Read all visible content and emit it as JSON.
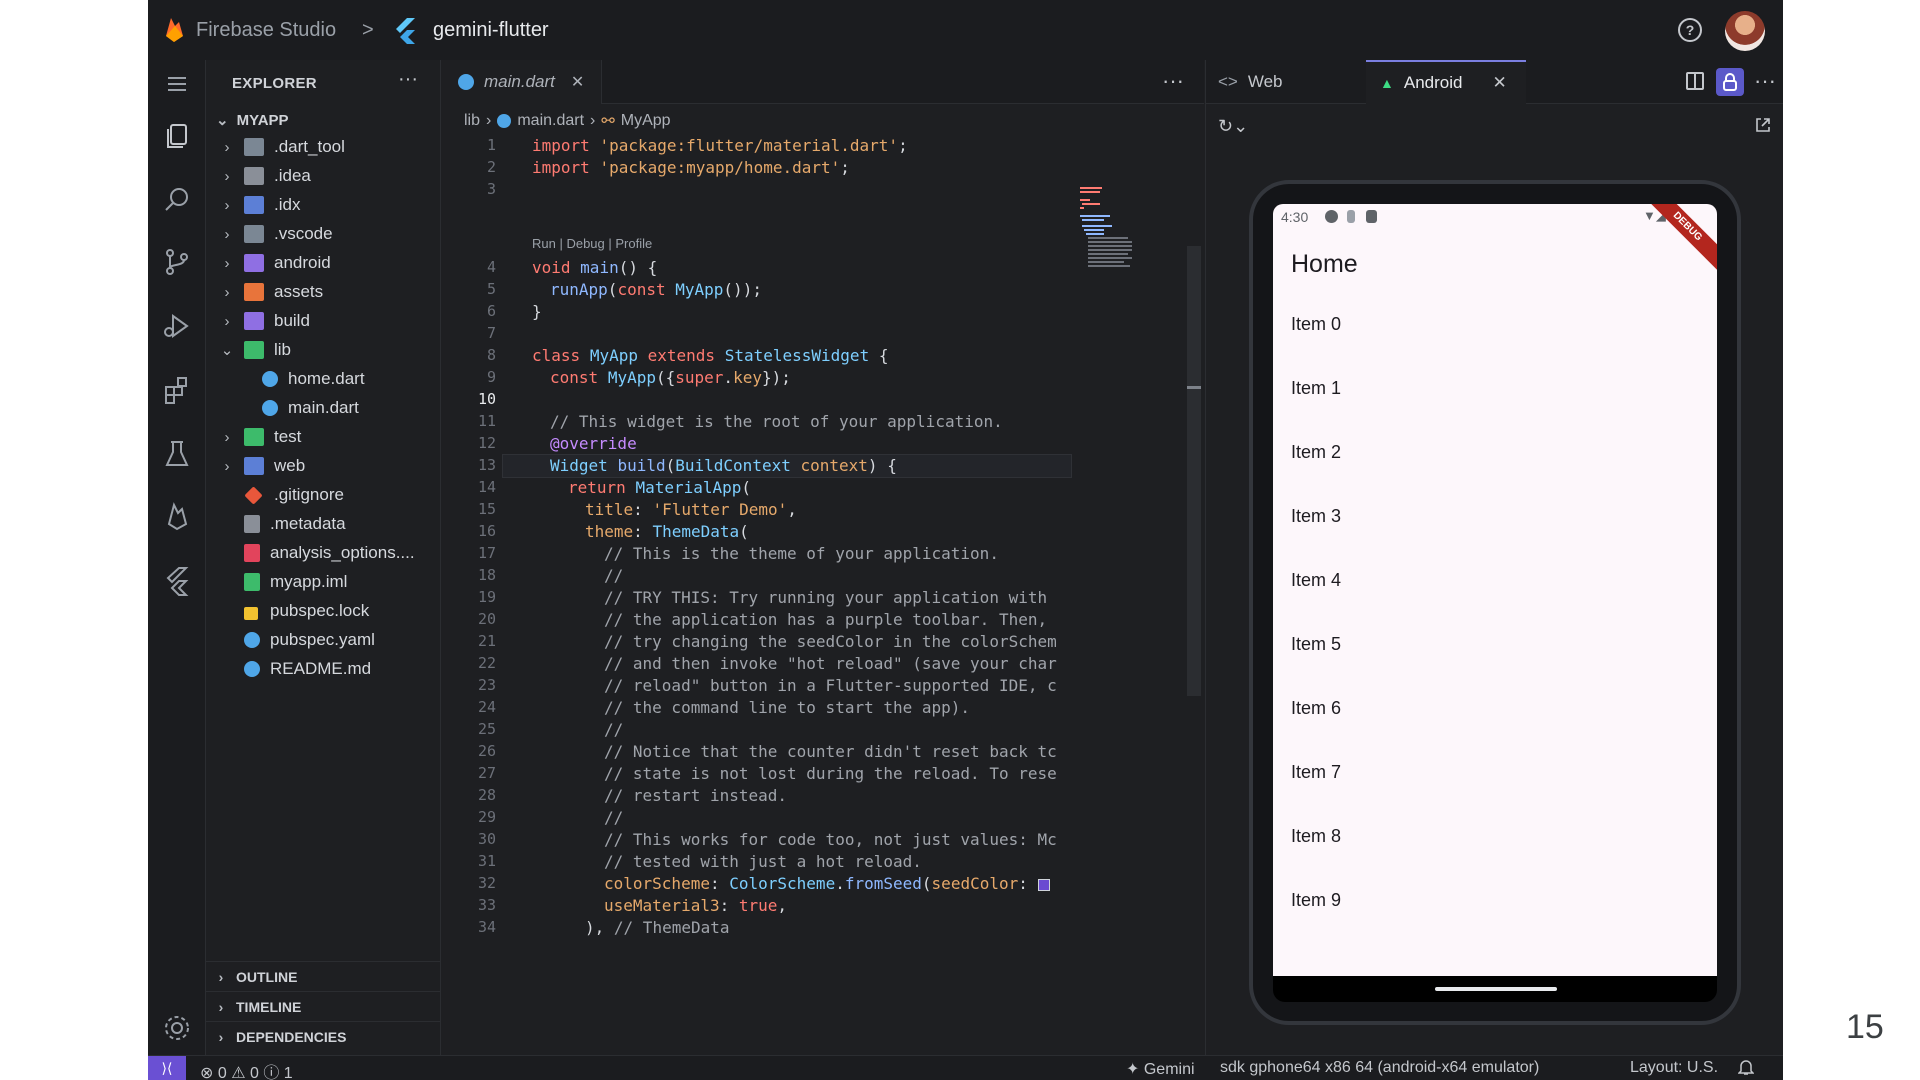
{
  "titlebar": {
    "brand": "Firebase Studio",
    "separator": ">",
    "project": "gemini-flutter",
    "help_icon": "help-circle-icon",
    "avatar": "user-avatar"
  },
  "activity_bar": {
    "icons": [
      "menu-icon",
      "files-icon",
      "search-icon",
      "source-control-icon",
      "run-debug-icon",
      "extensions-icon",
      "testing-icon",
      "firebase-icon",
      "flutter-icon",
      "settings-gear-icon"
    ]
  },
  "explorer": {
    "title": "EXPLORER",
    "more": "···",
    "root": "MYAPP",
    "items": [
      {
        "label": ".dart_tool",
        "type": "folder",
        "color": "#7b8794"
      },
      {
        "label": ".idea",
        "type": "folder",
        "color": "#8a8f98"
      },
      {
        "label": ".idx",
        "type": "folder",
        "color": "#5c7fd6"
      },
      {
        "label": ".vscode",
        "type": "folder",
        "color": "#7b8794"
      },
      {
        "label": "android",
        "type": "folder",
        "color": "#8f6fe3"
      },
      {
        "label": "assets",
        "type": "folder",
        "color": "#e8743b"
      },
      {
        "label": "build",
        "type": "folder",
        "color": "#8f6fe3"
      },
      {
        "label": "lib",
        "type": "folder-open",
        "color": "#3dbb6b"
      },
      {
        "label": "home.dart",
        "type": "dart",
        "color": "#4fa6e8"
      },
      {
        "label": "main.dart",
        "type": "dart",
        "color": "#4fa6e8"
      },
      {
        "label": "test",
        "type": "folder",
        "color": "#3dbb6b"
      },
      {
        "label": "web",
        "type": "folder",
        "color": "#5c7fd6"
      },
      {
        "label": ".gitignore",
        "type": "git",
        "color": "#e8573b"
      },
      {
        "label": ".metadata",
        "type": "file",
        "color": "#8a8f98"
      },
      {
        "label": "analysis_options....",
        "type": "yaml",
        "color": "#e2445c"
      },
      {
        "label": "myapp.iml",
        "type": "iml",
        "color": "#3dbb6b"
      },
      {
        "label": "pubspec.lock",
        "type": "lock",
        "color": "#f2c230"
      },
      {
        "label": "pubspec.yaml",
        "type": "dart",
        "color": "#4fa6e8"
      },
      {
        "label": "README.md",
        "type": "info",
        "color": "#4fa6e8"
      }
    ],
    "sections": [
      "OUTLINE",
      "TIMELINE",
      "DEPENDENCIES"
    ]
  },
  "editor": {
    "tab_label": "main.dart",
    "more": "···",
    "breadcrumb": {
      "folder": "lib",
      "file": "main.dart",
      "symbol": "MyApp"
    },
    "codelens": "Run | Debug | Profile",
    "current_line": "10",
    "lines": [
      {
        "n": "1",
        "text": ""
      },
      {
        "n": "2",
        "text": ""
      },
      {
        "n": "3",
        "text": ""
      },
      {
        "n": "4",
        "text": ""
      },
      {
        "n": "5",
        "text": ""
      },
      {
        "n": "6",
        "text": ""
      },
      {
        "n": "7",
        "text": ""
      },
      {
        "n": "8",
        "text": ""
      },
      {
        "n": "9",
        "text": ""
      },
      {
        "n": "10",
        "text": ""
      },
      {
        "n": "11",
        "text": ""
      },
      {
        "n": "12",
        "text": ""
      },
      {
        "n": "13",
        "text": ""
      },
      {
        "n": "14",
        "text": ""
      },
      {
        "n": "15",
        "text": ""
      },
      {
        "n": "16",
        "text": ""
      },
      {
        "n": "17",
        "text": ""
      },
      {
        "n": "18",
        "text": ""
      },
      {
        "n": "19",
        "text": ""
      },
      {
        "n": "20",
        "text": ""
      },
      {
        "n": "21",
        "text": ""
      },
      {
        "n": "22",
        "text": ""
      },
      {
        "n": "23",
        "text": ""
      },
      {
        "n": "24",
        "text": ""
      },
      {
        "n": "25",
        "text": ""
      },
      {
        "n": "26",
        "text": ""
      },
      {
        "n": "27",
        "text": ""
      },
      {
        "n": "28",
        "text": ""
      },
      {
        "n": "29",
        "text": ""
      },
      {
        "n": "30",
        "text": ""
      },
      {
        "n": "31",
        "text": ""
      },
      {
        "n": "32",
        "text": ""
      },
      {
        "n": "33",
        "text": ""
      },
      {
        "n": "34",
        "text": ""
      }
    ],
    "code": {
      "l1_kw": "import",
      "l1_str": "'package:flutter/material.dart'",
      "l1_end": ";",
      "l2_kw": "import",
      "l2_str": "'package:myapp/home.dart'",
      "l2_end": ";",
      "l4_kw": "void",
      "l4_fn": "main",
      "l4_end": "() {",
      "l5_fn": "runApp",
      "l5_a": "(",
      "l5_kw": "const",
      "l5_t": "MyApp",
      "l5_end": "());",
      "l6": "}",
      "l8_kw1": "class",
      "l8_t1": "MyApp",
      "l8_kw2": "extends",
      "l8_t2": "StatelessWidget",
      "l8_end": "{",
      "l9_kw": "const",
      "l9_t": "MyApp",
      "l9_a": "({",
      "l9_kw2": "super",
      "l9_b": ".",
      "l9_key": "key",
      "l9_end": "});",
      "l11": "// This widget is the root of your application.",
      "l12": "@override",
      "l13_t": "Widget",
      "l13_fn": "build",
      "l13_a": "(",
      "l13_t2": "BuildContext",
      "l13_p": "context",
      "l13_end": ") {",
      "l14_kw": "return",
      "l14_t": "MaterialApp",
      "l14_end": "(",
      "l15_p": "title",
      "l15_a": ": ",
      "l15_s": "'Flutter Demo'",
      "l15_end": ",",
      "l16_p": "theme",
      "l16_a": ": ",
      "l16_t": "ThemeData",
      "l16_end": "(",
      "l17": "// This is the theme of your application.",
      "l18": "//",
      "l19": "// TRY THIS: Try running your application with",
      "l20": "// the application has a purple toolbar. Then,",
      "l21": "// try changing the seedColor in the colorSchem",
      "l22": "// and then invoke \"hot reload\" (save your char",
      "l23": "// reload\" button in a Flutter-supported IDE, c",
      "l24": "// the command line to start the app).",
      "l25": "//",
      "l26": "// Notice that the counter didn't reset back tc",
      "l27": "// state is not lost during the reload. To rese",
      "l28": "// restart instead.",
      "l29": "//",
      "l30": "// This works for code too, not just values: Mc",
      "l31": "// tested with just a hot reload.",
      "l32_p": "colorScheme",
      "l32_a": ": ",
      "l32_t": "ColorScheme",
      "l32_b": ".",
      "l32_fn": "fromSeed",
      "l32_c": "(",
      "l32_p2": "seedColor",
      "l32_d": ": ",
      "l33_p": "useMaterial3",
      "l33_a": ": ",
      "l33_kw": "true",
      "l33_end": ",",
      "l34_a": "), ",
      "l34_c": "// ThemeData"
    }
  },
  "preview": {
    "tab_web": "Web",
    "tab_android": "Android",
    "device": {
      "time": "4:30",
      "debug_banner": "DEBUG",
      "app_title": "Home",
      "items": [
        "Item 0",
        "Item 1",
        "Item 2",
        "Item 3",
        "Item 4",
        "Item 5",
        "Item 6",
        "Item 7",
        "Item 8",
        "Item 9"
      ]
    }
  },
  "statusbar": {
    "problems": "⊗ 0 ⚠ 0 ⓘ 1",
    "gemini": "✦ Gemini",
    "sdk": "sdk gphone64 x86 64 (android-x64 emulator)",
    "layout": "Layout: U.S."
  },
  "page_number": "15"
}
